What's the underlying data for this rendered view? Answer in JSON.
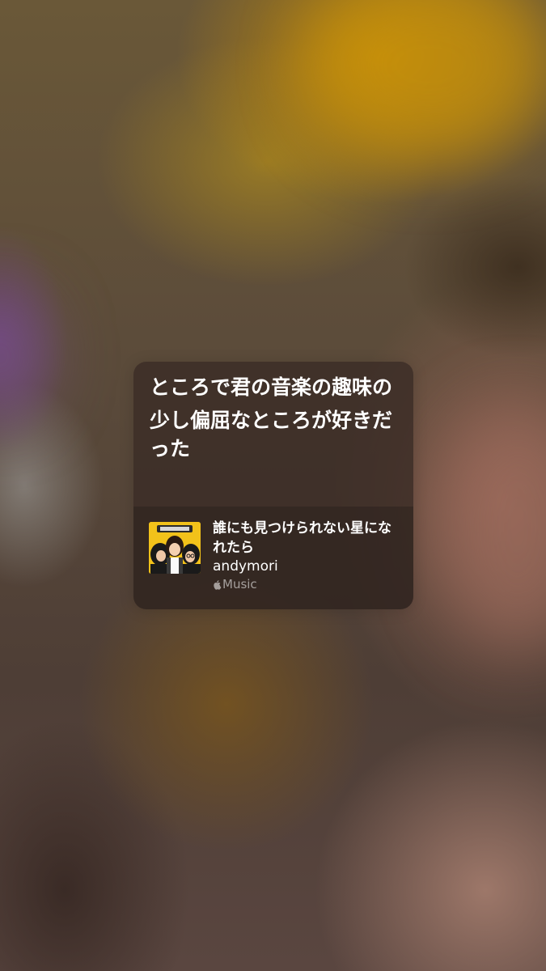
{
  "lyrics": {
    "lines": [
      "ところで君の音楽の趣味の",
      "少し偏屈なところが好きだった"
    ]
  },
  "song": {
    "title": "誰にも見つけられない星になれたら",
    "artist": "andymori",
    "artwork_icon": "album-artwork",
    "source_icon": "apple-logo-icon",
    "source_label": "Music"
  },
  "colors": {
    "card_background": "#3a2c26",
    "text_primary": "#ffffff",
    "text_secondary": "#9a908c",
    "artwork_yellow": "#f2c21a"
  }
}
